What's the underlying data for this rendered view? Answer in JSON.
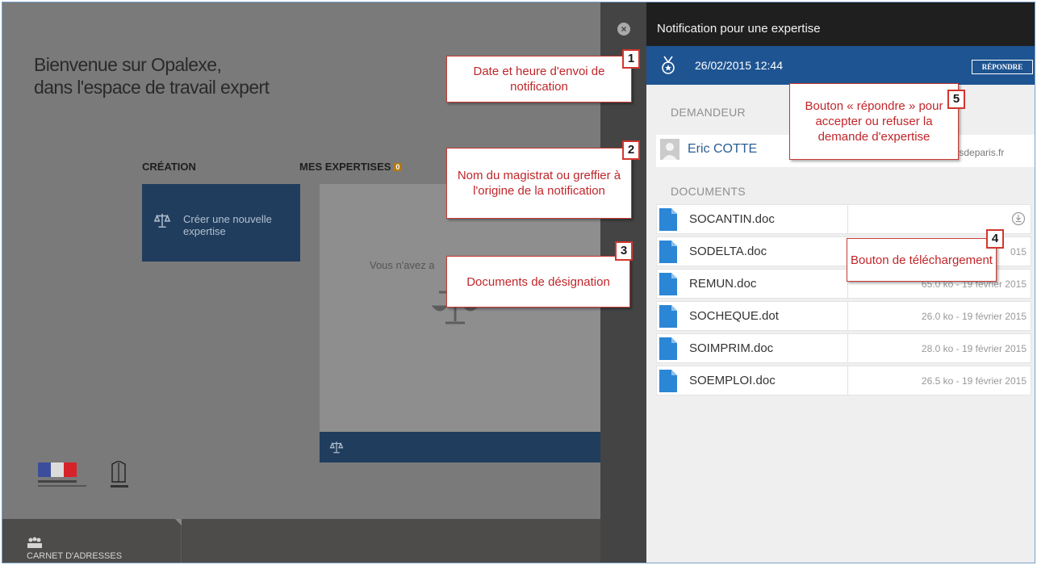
{
  "workspace": {
    "welcome_line1": "Bienvenue sur Opalexe,",
    "welcome_line2": "dans l'espace de travail expert",
    "creation_title": "CRÉATION",
    "create_tile_label": "Créer une nouvelle expertise",
    "mes_expertises_title": "MES EXPERTISES",
    "mes_expertises_count": "0",
    "empty_text": "Vous n'avez a",
    "footer_address_label": "CARNET D'ADRESSES"
  },
  "drawer": {
    "title": "Notification pour une expertise",
    "datetime": "26/02/2015 12:44",
    "reply_label": "RÉPONDRE",
    "requester_section": "DEMANDEUR",
    "requester_name": "Eric COTTE",
    "requester_email": "coursdeparis.fr",
    "documents_section": "DOCUMENTS",
    "documents": [
      {
        "name": "SOCANTIN.doc",
        "meta": ""
      },
      {
        "name": "SODELTA.doc",
        "meta": "015"
      },
      {
        "name": "REMUN.doc",
        "meta": "65.0 ko - 19 février 2015"
      },
      {
        "name": "SOCHEQUE.dot",
        "meta": "26.0 ko - 19 février 2015"
      },
      {
        "name": "SOIMPRIM.doc",
        "meta": "28.0 ko - 19 février 2015"
      },
      {
        "name": "SOEMPLOI.doc",
        "meta": "26.5 ko - 19 février 2015"
      }
    ]
  },
  "callouts": {
    "c1_num": "1",
    "c1_text": "Date et heure d'envoi de notification",
    "c2_num": "2",
    "c2_text": "Nom du magistrat ou greffier à l'origine de la notification",
    "c3_num": "3",
    "c3_text": "Documents de désignation",
    "c4_num": "4",
    "c4_text": "Bouton de téléchargement",
    "c5_num": "5",
    "c5_text": "Bouton « répondre » pour accepter ou refuser la demande d'expertise"
  },
  "colors": {
    "accent_blue": "#1e5491",
    "tile_navy": "#203d5d",
    "callout_red": "#c0262a"
  },
  "icons": [
    "scales-icon",
    "medal-icon",
    "user-avatar-icon",
    "file-icon",
    "download-icon",
    "close-icon",
    "address-book-icon"
  ]
}
